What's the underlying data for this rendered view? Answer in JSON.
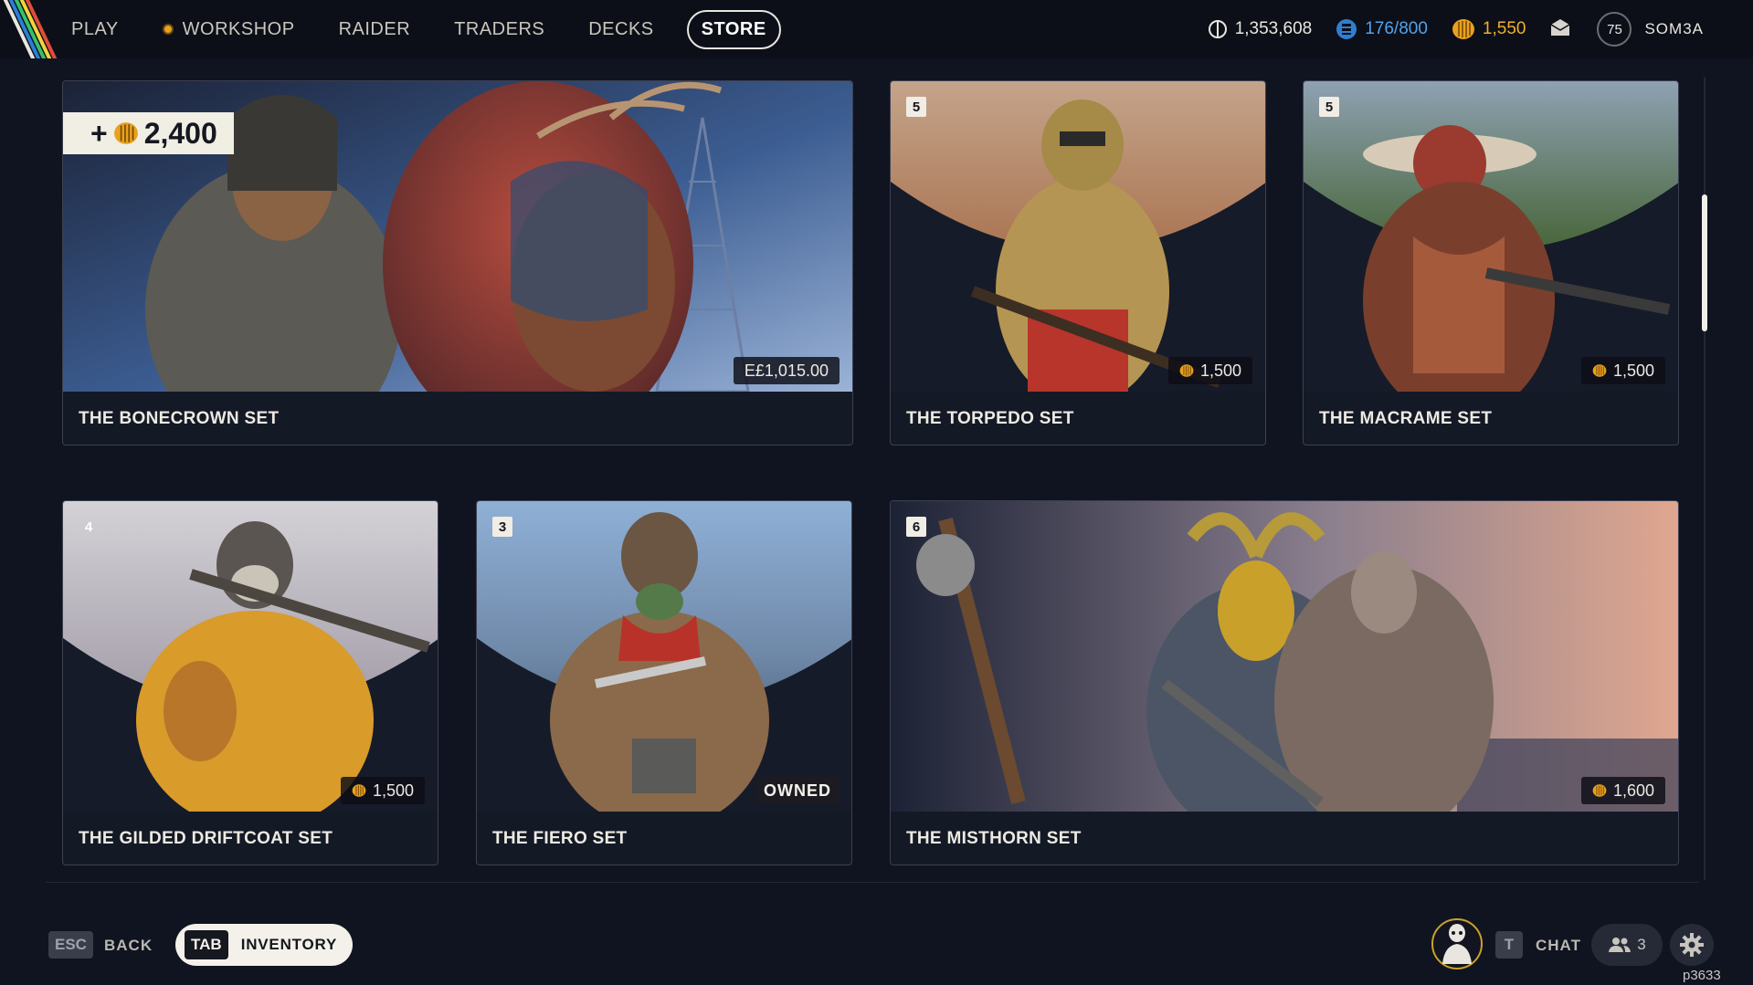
{
  "nav": {
    "items": [
      {
        "label": "PLAY"
      },
      {
        "label": "WORKSHOP"
      },
      {
        "label": "RAIDER"
      },
      {
        "label": "TRADERS"
      },
      {
        "label": "DECKS"
      },
      {
        "label": "STORE"
      }
    ],
    "active": "STORE"
  },
  "currencies": {
    "credits": "1,353,608",
    "capacity": "176/800",
    "premium": "1,550"
  },
  "profile": {
    "level": "75",
    "username": "SOM3A"
  },
  "cards": [
    {
      "title": "THE BONECROWN SET",
      "price": "E£1,015.00",
      "bonus": "2,400",
      "bonus_prefix": "+"
    },
    {
      "title": "THE TORPEDO SET",
      "price": "1,500",
      "count": "5"
    },
    {
      "title": "THE MACRAME SET",
      "price": "1,500",
      "count": "5"
    },
    {
      "title": "THE GILDED DRIFTCOAT SET",
      "price": "1,500",
      "count": "4"
    },
    {
      "title": "THE FIERO SET",
      "status": "OWNED",
      "count": "3"
    },
    {
      "title": "THE MISTHORN SET",
      "price": "1,600",
      "count": "6"
    }
  ],
  "bottom": {
    "esc_key": "ESC",
    "back_label": "BACK",
    "tab_key": "TAB",
    "inventory_label": "INVENTORY",
    "chat_key": "T",
    "chat_label": "CHAT",
    "party_count": "3",
    "build_id": "p3633"
  },
  "colors": {
    "background": "#101421",
    "premium_gold": "#f0b02a",
    "capacity_blue": "#52a3ec"
  },
  "icons": [
    "logo-stripes-icon",
    "workshop-dot-icon",
    "credits-icon",
    "capacity-icon",
    "premium-coin-icon",
    "mail-icon",
    "party-icon",
    "gear-icon"
  ]
}
